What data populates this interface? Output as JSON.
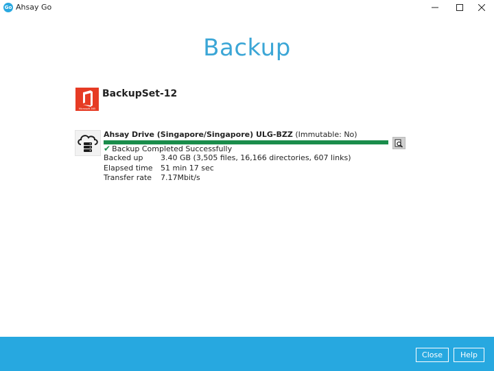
{
  "window": {
    "title": "Ahsay Go",
    "logo_text": "Go"
  },
  "page": {
    "heading": "Backup"
  },
  "backupset": {
    "name": "BackupSet-12",
    "icon": "microsoft-365-icon",
    "icon_caption": "Microsoft 365"
  },
  "destination": {
    "name": "Ahsay Drive (Singapore/Singapore) ULG-BZZ",
    "immutable_text": "(Immutable: No)",
    "icon": "cloud-server-icon",
    "progress_fraction": 1.0,
    "status": "Backup Completed Successfully",
    "details": [
      {
        "label": "Backed up",
        "value": "3.40 GB (3,505 files, 16,166 directories, 607 links)"
      },
      {
        "label": "Elapsed time",
        "value": "51 min 17 sec"
      },
      {
        "label": "Transfer rate",
        "value": "7.17Mbit/s"
      }
    ]
  },
  "footer": {
    "close_label": "Close",
    "help_label": "Help"
  },
  "colors": {
    "accent": "#27a8e0",
    "heading": "#3ba6d6",
    "progress": "#1a8d4b",
    "office_red": "#e63b24"
  }
}
